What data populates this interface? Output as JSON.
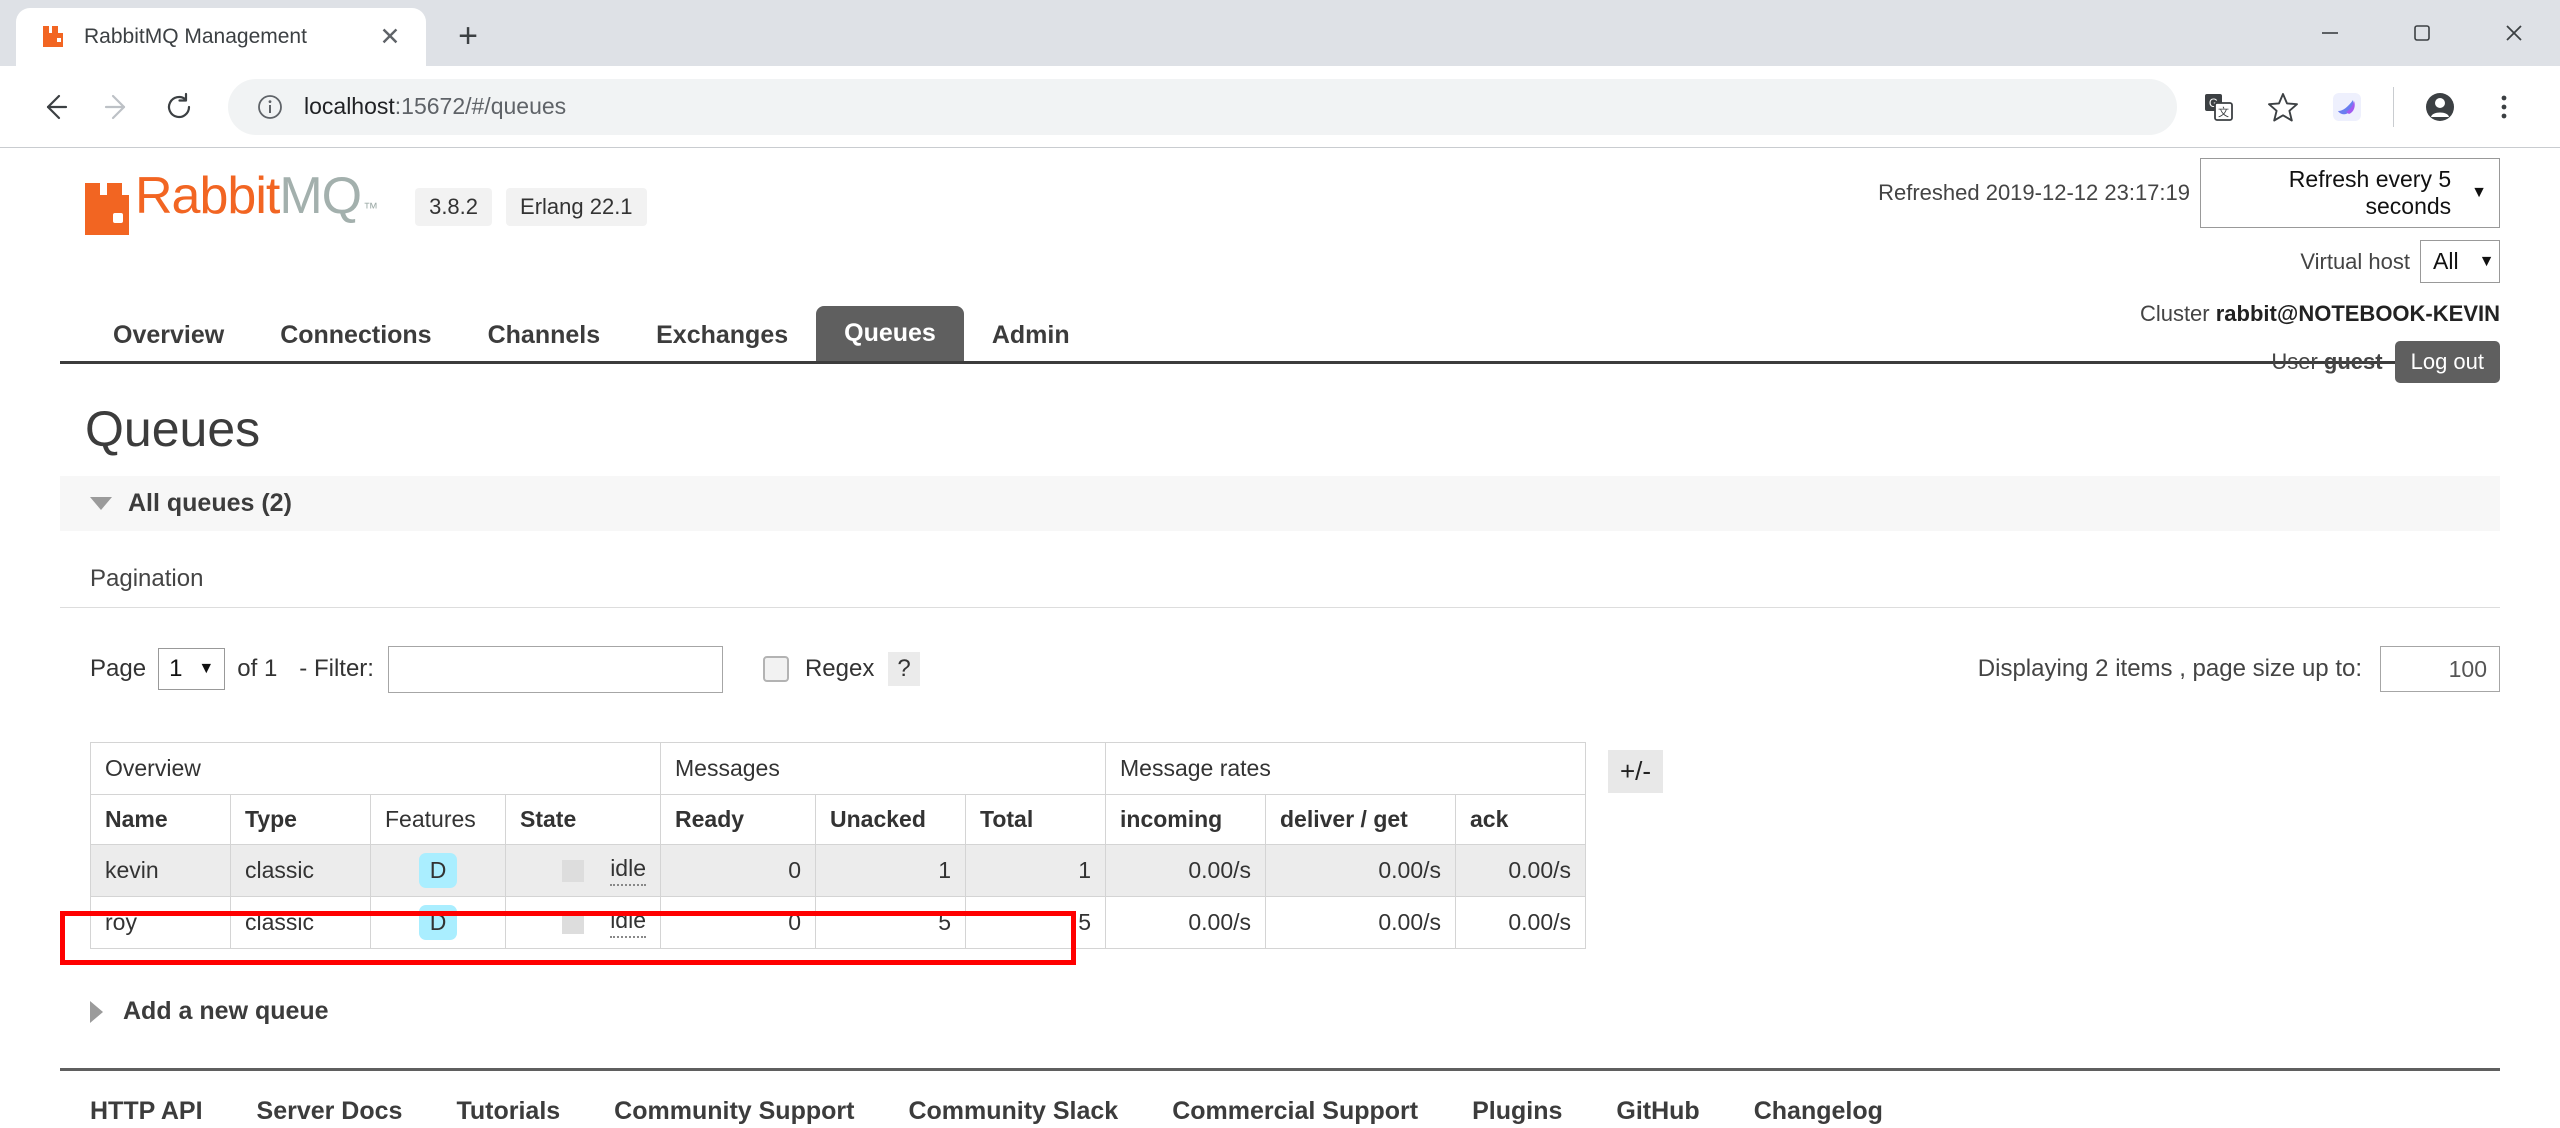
{
  "browser": {
    "tab": {
      "title": "RabbitMQ Management",
      "favicon": "rabbitmq-favicon",
      "close_label": "✕"
    },
    "new_tab_label": "+",
    "window_controls": {
      "minimize": "—",
      "maximize": "❐",
      "close": "✕"
    },
    "nav": {
      "back": "←",
      "forward": "→",
      "reload": "⟳"
    },
    "omnibox": {
      "host": "localhost",
      "rest": ":15672/#/queues",
      "full_url": "localhost:15672/#/queues",
      "info_icon": "ⓘ"
    },
    "icons": {
      "translate": "translate-icon",
      "bookmark": "☆",
      "extension": "extension-icon",
      "profile": "profile-avatar-icon",
      "menu": "⋮"
    }
  },
  "header": {
    "logo": {
      "orange_part": "Rabbit",
      "gray_part": "MQ",
      "tm": "™"
    },
    "version_badge": "3.8.2",
    "erlang_badge": "Erlang 22.1",
    "refreshed_label": "Refreshed 2019-12-12 23:17:19",
    "refresh_select": {
      "value": "Refresh every 5 seconds",
      "caret": "▼"
    },
    "vhost_label": "Virtual host",
    "vhost_select": {
      "value": "All",
      "caret": "▼"
    },
    "cluster_label": "Cluster",
    "cluster_name": "rabbit@NOTEBOOK-KEVIN",
    "user_label": "User",
    "user_name": "guest",
    "logout_label": "Log out"
  },
  "nav_tabs": [
    {
      "label": "Overview",
      "active": false
    },
    {
      "label": "Connections",
      "active": false
    },
    {
      "label": "Channels",
      "active": false
    },
    {
      "label": "Exchanges",
      "active": false
    },
    {
      "label": "Queues",
      "active": true
    },
    {
      "label": "Admin",
      "active": false
    }
  ],
  "main": {
    "page_title": "Queues",
    "all_queues_label": "All queues (2)",
    "pagination_label": "Pagination",
    "page_word": "Page",
    "page_value": "1",
    "page_caret": "▼",
    "of_label": "of 1",
    "filter_label": "- Filter:",
    "filter_value": "",
    "filter_placeholder": "",
    "regex_label": "Regex",
    "help_label": "?",
    "displaying_label": "Displaying 2 items , page size up to:",
    "page_size_value": "100",
    "plus_minus_label": "+/-",
    "add_queue_label": "Add a new queue"
  },
  "table": {
    "group_headers": [
      {
        "label": "Overview",
        "colspan": 4
      },
      {
        "label": "Messages",
        "colspan": 3
      },
      {
        "label": "Message rates",
        "colspan": 3
      }
    ],
    "columns": [
      {
        "label": "Name",
        "align": "left",
        "bold": true
      },
      {
        "label": "Type",
        "align": "left",
        "bold": true
      },
      {
        "label": "Features",
        "align": "left",
        "bold": false
      },
      {
        "label": "State",
        "align": "left",
        "bold": true
      },
      {
        "label": "Ready",
        "align": "left",
        "bold": true
      },
      {
        "label": "Unacked",
        "align": "left",
        "bold": true
      },
      {
        "label": "Total",
        "align": "left",
        "bold": true
      },
      {
        "label": "incoming",
        "align": "left",
        "bold": true
      },
      {
        "label": "deliver / get",
        "align": "left",
        "bold": true
      },
      {
        "label": "ack",
        "align": "left",
        "bold": true
      }
    ],
    "rows": [
      {
        "name": "kevin",
        "type": "classic",
        "features": "D",
        "state": "idle",
        "ready": "0",
        "unacked": "1",
        "total": "1",
        "incoming": "0.00/s",
        "deliver_get": "0.00/s",
        "ack": "0.00/s",
        "alt": true,
        "highlighted": false
      },
      {
        "name": "roy",
        "type": "classic",
        "features": "D",
        "state": "idle",
        "ready": "0",
        "unacked": "5",
        "total": "5",
        "incoming": "0.00/s",
        "deliver_get": "0.00/s",
        "ack": "0.00/s",
        "alt": false,
        "highlighted": true
      }
    ]
  },
  "footer_links": [
    "HTTP API",
    "Server Docs",
    "Tutorials",
    "Community Support",
    "Community Slack",
    "Commercial Support",
    "Plugins",
    "GitHub",
    "Changelog"
  ],
  "colors": {
    "brand_orange": "#f26522",
    "brand_gray": "#a3b0ad",
    "active_tab_bg": "#5f5f5f",
    "feature_badge_bg": "#aaeeff",
    "highlight_red": "#ff0000"
  }
}
